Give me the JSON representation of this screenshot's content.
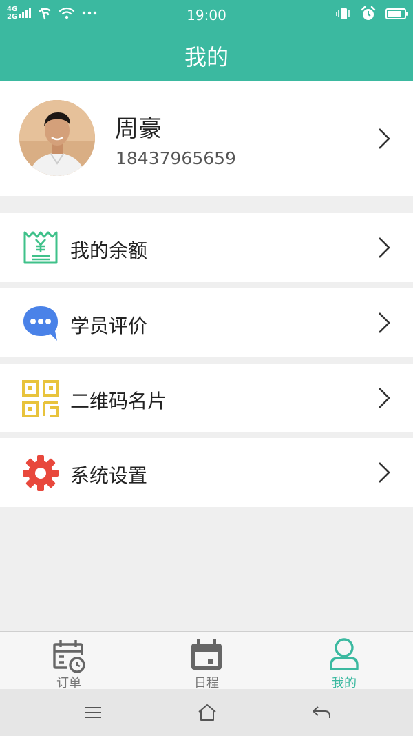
{
  "status_bar": {
    "network_top": "4G",
    "network_bottom": "2G",
    "time": "19:00",
    "battery_level": 0.85
  },
  "header": {
    "title": "我的"
  },
  "profile": {
    "name": "周豪",
    "phone": "18437965659"
  },
  "menu": [
    {
      "label": "我的余额",
      "icon": "wallet-receipt-icon"
    },
    {
      "label": "学员评价",
      "icon": "chat-bubble-icon"
    },
    {
      "label": "二维码名片",
      "icon": "qr-code-icon"
    },
    {
      "label": "系统设置",
      "icon": "gear-icon"
    }
  ],
  "tabs": [
    {
      "label": "订单",
      "icon": "calendar-clock-icon",
      "active": false
    },
    {
      "label": "日程",
      "icon": "calendar-icon",
      "active": false
    },
    {
      "label": "我的",
      "icon": "person-icon",
      "active": true
    }
  ],
  "colors": {
    "brand": "#3bb9a0",
    "active_tab": "#3bb9a0",
    "inactive_tab": "#777777",
    "balance_icon": "#3fc18a",
    "comment_icon": "#4a82e8",
    "qr_icon": "#e8c33c",
    "settings_icon": "#e8483c"
  }
}
